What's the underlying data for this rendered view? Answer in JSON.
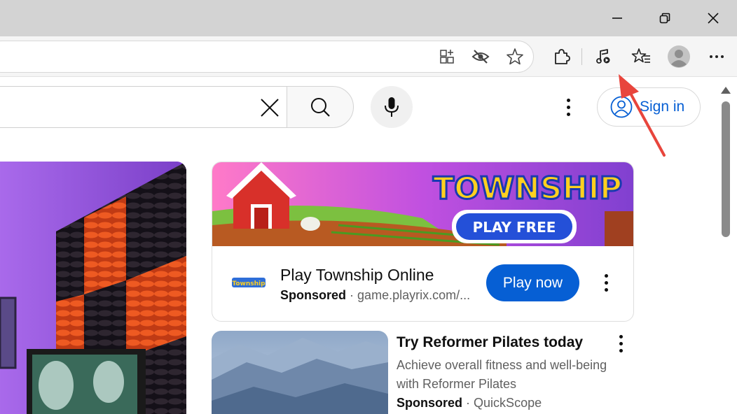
{
  "browser": {
    "window_controls": [
      "minimize",
      "restore",
      "close"
    ],
    "address_icons": [
      "split-screen-icon",
      "tracking-prevention-icon",
      "favorite-star-icon"
    ],
    "toolbar_icons": [
      "extensions-icon",
      "media-control-icon",
      "favorites-icon",
      "profile-icon",
      "more-icon"
    ]
  },
  "header": {
    "search_value": "",
    "signin_label": "Sign in"
  },
  "ad": {
    "banner_title": "TOWNSHIP",
    "banner_cta": "PLAY FREE",
    "logo_text": "Township",
    "title": "Play Township Online",
    "sponsored_label": "Sponsored",
    "separator": "·",
    "domain": "game.playrix.com/...",
    "cta_label": "Play now"
  },
  "item": {
    "title": "Try Reformer Pilates today",
    "desc_line1": "Achieve overall fitness and well-being",
    "desc_line2": "with Reformer Pilates",
    "sponsored_label": "Sponsored",
    "separator": "·",
    "advertiser": "QuickScope"
  },
  "colors": {
    "accent_blue": "#065fd4",
    "annotation_arrow": "#e8453c",
    "titlebar": "#d3d3d3"
  }
}
